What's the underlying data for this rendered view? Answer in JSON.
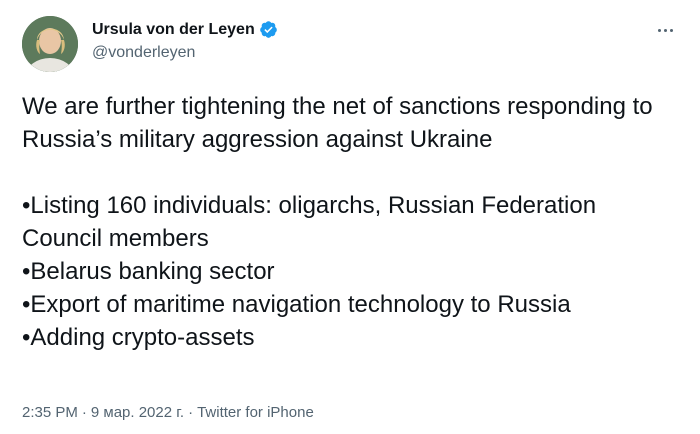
{
  "author": {
    "display_name": "Ursula von der Leyen",
    "handle": "@vonderleyen",
    "verified_icon": "verified-badge-icon",
    "avatar_icon": "profile-photo"
  },
  "menu": {
    "icon": "more-options-icon"
  },
  "tweet": {
    "text": "We are further tightening the net of sanctions responding to Russia’s military aggression against Ukraine\n\n•Listing 160 individuals: oligarchs, Russian Federation Council members\n•Belarus banking sector\n•Export of maritime navigation technology to Russia\n•Adding crypto-assets"
  },
  "meta": {
    "time": "2:35 PM",
    "separator": "·",
    "date": "9 мар. 2022 г.",
    "source": "Twitter for iPhone"
  },
  "colors": {
    "accent": "#1d9bf0",
    "text": "#0f1419",
    "muted": "#536471"
  }
}
